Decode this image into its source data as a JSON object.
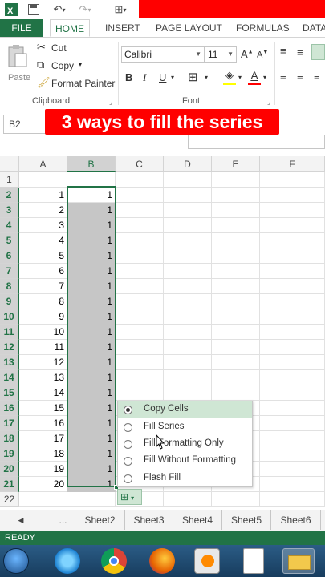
{
  "ribbon_tabs": [
    "FILE",
    "HOME",
    "INSERT",
    "PAGE LAYOUT",
    "FORMULAS",
    "DATA"
  ],
  "clipboard": {
    "paste": "Paste",
    "cut": "Cut",
    "copy": "Copy",
    "format_painter": "Format Painter",
    "group_label": "Clipboard"
  },
  "font": {
    "name": "Calibri",
    "size": "11",
    "bold": "B",
    "italic": "I",
    "underline": "U",
    "group_label": "Font"
  },
  "name_box": "B2",
  "banner": "3 ways to fill the series",
  "columns": [
    "A",
    "B",
    "C",
    "D",
    "E",
    "F"
  ],
  "rows": [
    {
      "n": "1",
      "a": "",
      "b": ""
    },
    {
      "n": "2",
      "a": "1",
      "b": "1"
    },
    {
      "n": "3",
      "a": "2",
      "b": "1"
    },
    {
      "n": "4",
      "a": "3",
      "b": "1"
    },
    {
      "n": "5",
      "a": "4",
      "b": "1"
    },
    {
      "n": "6",
      "a": "5",
      "b": "1"
    },
    {
      "n": "7",
      "a": "6",
      "b": "1"
    },
    {
      "n": "8",
      "a": "7",
      "b": "1"
    },
    {
      "n": "9",
      "a": "8",
      "b": "1"
    },
    {
      "n": "10",
      "a": "9",
      "b": "1"
    },
    {
      "n": "11",
      "a": "10",
      "b": "1"
    },
    {
      "n": "12",
      "a": "11",
      "b": "1"
    },
    {
      "n": "13",
      "a": "12",
      "b": "1"
    },
    {
      "n": "14",
      "a": "13",
      "b": "1"
    },
    {
      "n": "15",
      "a": "14",
      "b": "1"
    },
    {
      "n": "16",
      "a": "15",
      "b": "1"
    },
    {
      "n": "17",
      "a": "16",
      "b": "1"
    },
    {
      "n": "18",
      "a": "17",
      "b": "1"
    },
    {
      "n": "19",
      "a": "18",
      "b": "1"
    },
    {
      "n": "20",
      "a": "19",
      "b": "1"
    },
    {
      "n": "21",
      "a": "20",
      "b": "1"
    },
    {
      "n": "22",
      "a": "",
      "b": ""
    }
  ],
  "autofill_menu": [
    "Copy Cells",
    "Fill Series",
    "Fill Formatting Only",
    "Fill Without Formatting",
    "Flash Fill"
  ],
  "sheet_tabs": [
    "...",
    "Sheet2",
    "Sheet3",
    "Sheet4",
    "Sheet5",
    "Sheet6"
  ],
  "status": "READY",
  "colors": {
    "excel_green": "#217346",
    "red": "#ff0000",
    "fill_gray": "#c6c6c6"
  }
}
